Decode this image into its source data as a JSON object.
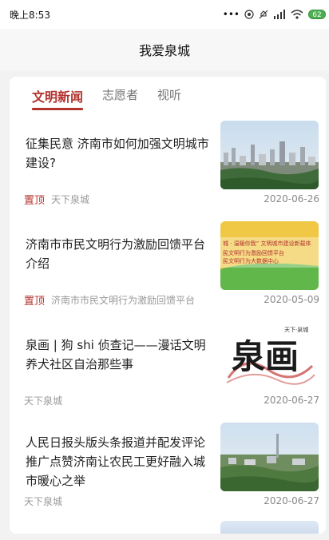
{
  "status_bar": {
    "time": "晚上8:53",
    "icons": [
      "more-dots-icon",
      "hotspot-icon",
      "mute-icon",
      "signal-icon",
      "wifi-icon"
    ],
    "battery": "62"
  },
  "header": {
    "title": "我爱泉城"
  },
  "tabs": [
    {
      "label": "文明新闻",
      "active": true
    },
    {
      "label": "志愿者",
      "active": false
    },
    {
      "label": "视听",
      "active": false
    }
  ],
  "colors": {
    "accent": "#b3322e",
    "card_bg": "#ffffff",
    "page_bg": "#f2f2f2"
  },
  "news": [
    {
      "title": "征集民意 济南市如何加强文明城市建设?",
      "pinned": "置顶",
      "source": "天下泉城",
      "date": "2020-06-26",
      "thumb": "city-skyline-photo"
    },
    {
      "title": "济南市市民文明行为激励回馈平台介绍",
      "pinned": "置顶",
      "source": "济南市市民文明行为激励回馈平台",
      "date": "2020-05-09",
      "thumb": "banner-graphic",
      "thumb_line1": "城 · 温暖你我” 文明城市建设新载体",
      "thumb_line2": "民文明行为激励回馈平台",
      "thumb_line3": "民文明行为大数据中心"
    },
    {
      "title": "泉画 | 狗 shi 侦查记——漫话文明养犬社区自治那些事",
      "pinned": "",
      "source": "天下泉城",
      "date": "2020-06-27",
      "thumb": "calligraphy-logo",
      "thumb_text": "泉画",
      "thumb_small": "天下·泉城"
    },
    {
      "title": "人民日报头版头条报道并配发评论 推广点赞济南让农民工更好融入城市暖心之举",
      "pinned": "",
      "source": "天下泉城",
      "date": "2020-06-27",
      "thumb": "city-aerial-photo"
    }
  ]
}
